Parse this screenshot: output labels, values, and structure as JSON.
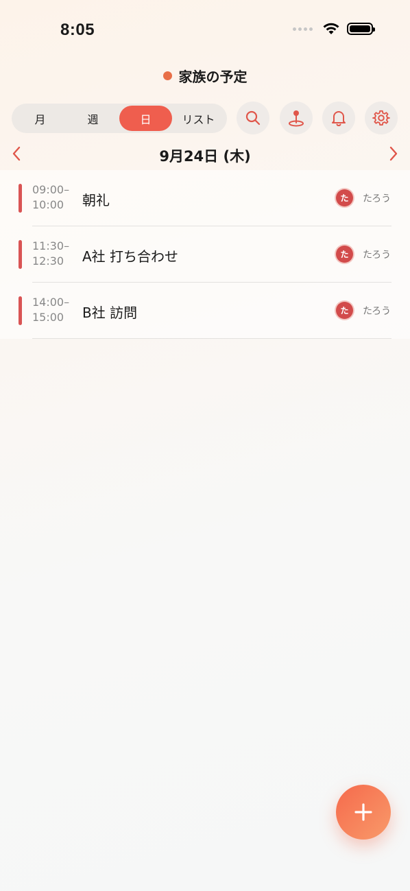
{
  "status_bar": {
    "time": "8:05"
  },
  "header": {
    "title": "家族の予定",
    "dot_color": "#e86f48"
  },
  "view_tabs": [
    {
      "label": "月",
      "active": false
    },
    {
      "label": "週",
      "active": false
    },
    {
      "label": "日",
      "active": true
    },
    {
      "label": "リスト",
      "active": false
    }
  ],
  "toolbar_icons": [
    "search-icon",
    "location-pin-icon",
    "bell-icon",
    "gear-icon"
  ],
  "date_nav": {
    "date_label": "9月24日 (木)"
  },
  "events": [
    {
      "start": "09:00–",
      "end": "10:00",
      "title": "朝礼",
      "avatar": "た",
      "owner": "たろう"
    },
    {
      "start": "11:30–",
      "end": "12:30",
      "title": "A社 打ち合わせ",
      "avatar": "た",
      "owner": "たろう"
    },
    {
      "start": "14:00–",
      "end": "15:00",
      "title": "B社 訪問",
      "avatar": "た",
      "owner": "たろう"
    }
  ],
  "colors": {
    "accent": "#ef5e4e",
    "event_bar": "#d95454",
    "avatar": "#d24b4b"
  }
}
